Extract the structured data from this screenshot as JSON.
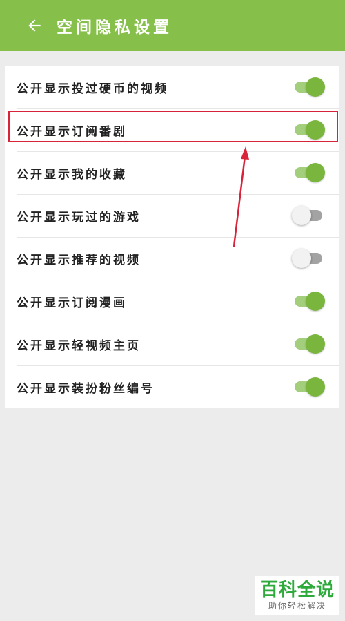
{
  "appbar": {
    "title": "空间隐私设置",
    "back_icon": "arrow-left-icon"
  },
  "settings": [
    {
      "label": "公开显示投过硬币的视频",
      "enabled": true
    },
    {
      "label": "公开显示订阅番剧",
      "enabled": true
    },
    {
      "label": "公开显示我的收藏",
      "enabled": true
    },
    {
      "label": "公开显示玩过的游戏",
      "enabled": false
    },
    {
      "label": "公开显示推荐的视频",
      "enabled": false
    },
    {
      "label": "公开显示订阅漫画",
      "enabled": true
    },
    {
      "label": "公开显示轻视频主页",
      "enabled": true
    },
    {
      "label": "公开显示装扮粉丝编号",
      "enabled": true
    }
  ],
  "watermark": {
    "title": "百科全说",
    "subtitle": "助你轻松解决"
  },
  "colors": {
    "accent": "#86bf4a",
    "switch_on": "#7ab63d",
    "highlight": "#d9233a"
  }
}
